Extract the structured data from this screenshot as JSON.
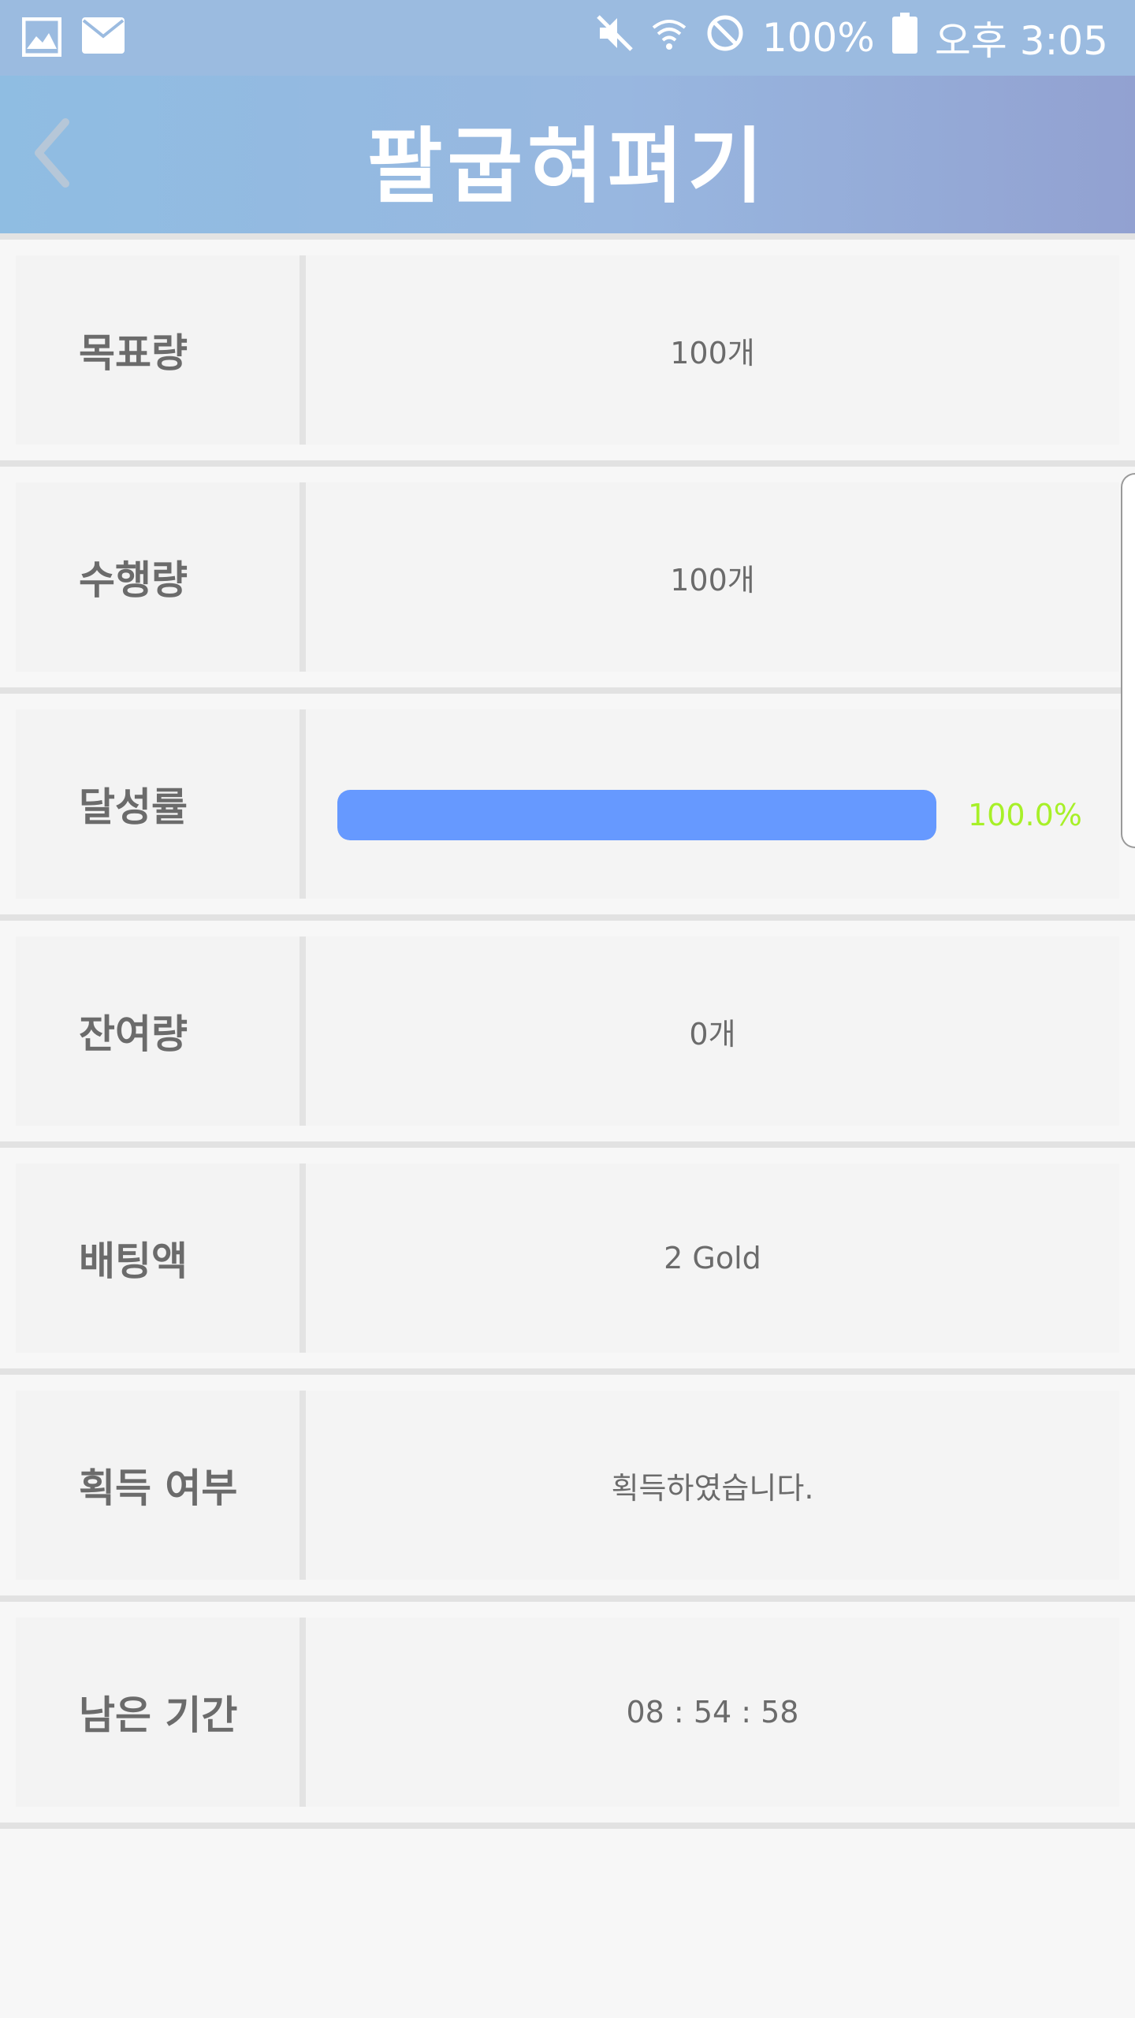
{
  "status_bar": {
    "battery": "100%",
    "time": "오후 3:05",
    "icons": [
      "gallery-icon",
      "mail-icon",
      "mute-icon",
      "wifi-icon",
      "blocked-icon",
      "battery-icon"
    ]
  },
  "header": {
    "title": "팔굽혀펴기",
    "back_icon": "chevron-left-icon"
  },
  "rows": [
    {
      "label": "목표량",
      "value": "100개"
    },
    {
      "label": "수행량",
      "value": "100개"
    },
    {
      "label": "달성률",
      "progress_text": "100.0%",
      "progress": 1.0
    },
    {
      "label": "잔여량",
      "value": "0개"
    },
    {
      "label": "배팅액",
      "value": "2 Gold"
    },
    {
      "label": "획득 여부",
      "value": "획득하였습니다."
    },
    {
      "label": "남은 기간",
      "value": "08 : 54 : 58"
    }
  ],
  "colors": {
    "header_start": "#8fbde2",
    "header_end": "#92a1d1",
    "progress_fill": "#6699ff",
    "progress_text": "#a7f028",
    "label_text": "#6b6b6b"
  }
}
